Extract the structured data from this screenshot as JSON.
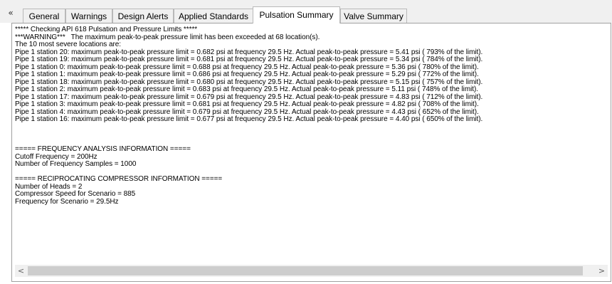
{
  "tabs": {
    "collapse_glyph": "«",
    "items": [
      {
        "label": "General"
      },
      {
        "label": "Warnings"
      },
      {
        "label": "Design Alerts"
      },
      {
        "label": "Applied Standards"
      },
      {
        "label": "Pulsation Summary",
        "active": true
      },
      {
        "label": "Valve Summary"
      }
    ]
  },
  "report": {
    "lines": [
      "***** Checking API 618 Pulsation and Pressure Limits *****",
      "***WARNING***   The maximum peak-to-peak pressure limit has been exceeded at 68 location(s).",
      "The 10 most severe locations are:",
      "Pipe 1 station 20: maximum peak-to-peak pressure limit = 0.682 psi at frequency 29.5 Hz. Actual peak-to-peak pressure = 5.41 psi ( 793% of the limit).",
      "Pipe 1 station 19: maximum peak-to-peak pressure limit = 0.681 psi at frequency 29.5 Hz. Actual peak-to-peak pressure = 5.34 psi ( 784% of the limit).",
      "Pipe 1 station 0: maximum peak-to-peak pressure limit = 0.688 psi at frequency 29.5 Hz. Actual peak-to-peak pressure = 5.36 psi ( 780% of the limit).",
      "Pipe 1 station 1: maximum peak-to-peak pressure limit = 0.686 psi at frequency 29.5 Hz. Actual peak-to-peak pressure = 5.29 psi ( 772% of the limit).",
      "Pipe 1 station 18: maximum peak-to-peak pressure limit = 0.680 psi at frequency 29.5 Hz. Actual peak-to-peak pressure = 5.15 psi ( 757% of the limit).",
      "Pipe 1 station 2: maximum peak-to-peak pressure limit = 0.683 psi at frequency 29.5 Hz. Actual peak-to-peak pressure = 5.11 psi ( 748% of the limit).",
      "Pipe 1 station 17: maximum peak-to-peak pressure limit = 0.679 psi at frequency 29.5 Hz. Actual peak-to-peak pressure = 4.83 psi ( 712% of the limit).",
      "Pipe 1 station 3: maximum peak-to-peak pressure limit = 0.681 psi at frequency 29.5 Hz. Actual peak-to-peak pressure = 4.82 psi ( 708% of the limit).",
      "Pipe 1 station 4: maximum peak-to-peak pressure limit = 0.679 psi at frequency 29.5 Hz. Actual peak-to-peak pressure = 4.43 psi ( 652% of the limit).",
      "Pipe 1 station 16: maximum peak-to-peak pressure limit = 0.677 psi at frequency 29.5 Hz. Actual peak-to-peak pressure = 4.40 psi ( 650% of the limit).",
      "",
      "",
      "",
      "===== FREQUENCY ANALYSIS INFORMATION =====",
      "Cutoff Frequency = 200Hz",
      "Number of Frequency Samples = 1000",
      "",
      "===== RECIPROCATING COMPRESSOR INFORMATION =====",
      "Number of Heads = 2",
      "Compressor Speed for Scenario = 885",
      "Frequency for Scenario = 29.5Hz"
    ]
  },
  "scrollbar": {
    "left_glyph": "<",
    "right_glyph": ">"
  }
}
